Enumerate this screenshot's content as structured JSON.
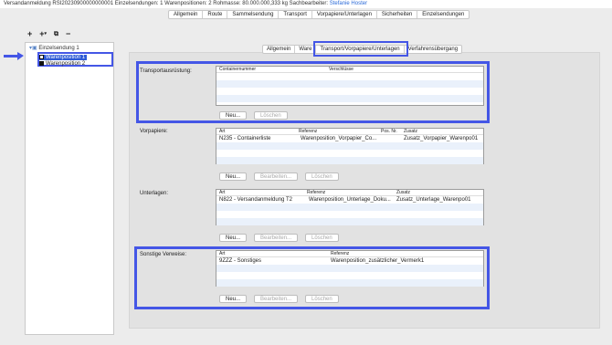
{
  "topbar": {
    "text_plain": "Versandanmeldung RSI20230900000000001   Einzelsendungen: 1   Warenpositionen: 2   Rohmasse: 80.000.000,333 kg   Sachbearbeiter: ",
    "user": "Stefanie Hoster"
  },
  "main_tabs": [
    "Allgemein",
    "Route",
    "Sammelsendung",
    "Transport",
    "Vorpapiere/Unterlagen",
    "Sicherheiten",
    "Einzelsendungen"
  ],
  "toolbar": {
    "add": "+",
    "add_menu": "+",
    "copy": "⧉",
    "remove": "−"
  },
  "tree": {
    "root": "Einzelsendung 1",
    "items": [
      "Warenposition 1",
      "Warenposition 2"
    ]
  },
  "sub_tabs": [
    "Allgemein",
    "Ware",
    "Transport/Vorpapiere/Unterlagen",
    "Verfahrensübergang"
  ],
  "sections": {
    "transport": {
      "label": "Transportausrüstung:",
      "columns": [
        "Containernummer",
        "Verschlüsse"
      ],
      "rows": [],
      "buttons": [
        "Neu...",
        "Löschen"
      ]
    },
    "vorpapiere": {
      "label": "Vorpapiere:",
      "columns": [
        "Art",
        "Referenz",
        "Pos. Nr.",
        "Zusatz"
      ],
      "rows": [
        [
          "N235 - Containerliste",
          "Warenposition_Vorpapier_Co...",
          "",
          "Zusatz_Vorpapier_Warenpo01"
        ]
      ],
      "buttons": [
        "Neu...",
        "Bearbeiten...",
        "Löschen"
      ]
    },
    "unterlagen": {
      "label": "Unterlagen:",
      "columns": [
        "Art",
        "Referenz",
        "Zusatz"
      ],
      "rows": [
        [
          "N822 - Versandanmeldung T2",
          "Warenposition_Unterlage_Doku...",
          "Zusatz_Unterlage_Warenpo01"
        ]
      ],
      "buttons": [
        "Neu...",
        "Bearbeiten...",
        "Löschen"
      ]
    },
    "sonstige": {
      "label": "Sonstige Verweise:",
      "columns": [
        "Art",
        "Referenz"
      ],
      "rows": [
        [
          "9ZZZ - Sonstiges",
          "Warenposition_zusätzlicher_Vermerk1"
        ]
      ],
      "buttons": [
        "Neu...",
        "Bearbeiten...",
        "Löschen"
      ]
    }
  },
  "colors": {
    "highlight": "#4456e6",
    "selection": "#2f5bd6",
    "row_stripe": "#eaf1fb"
  }
}
